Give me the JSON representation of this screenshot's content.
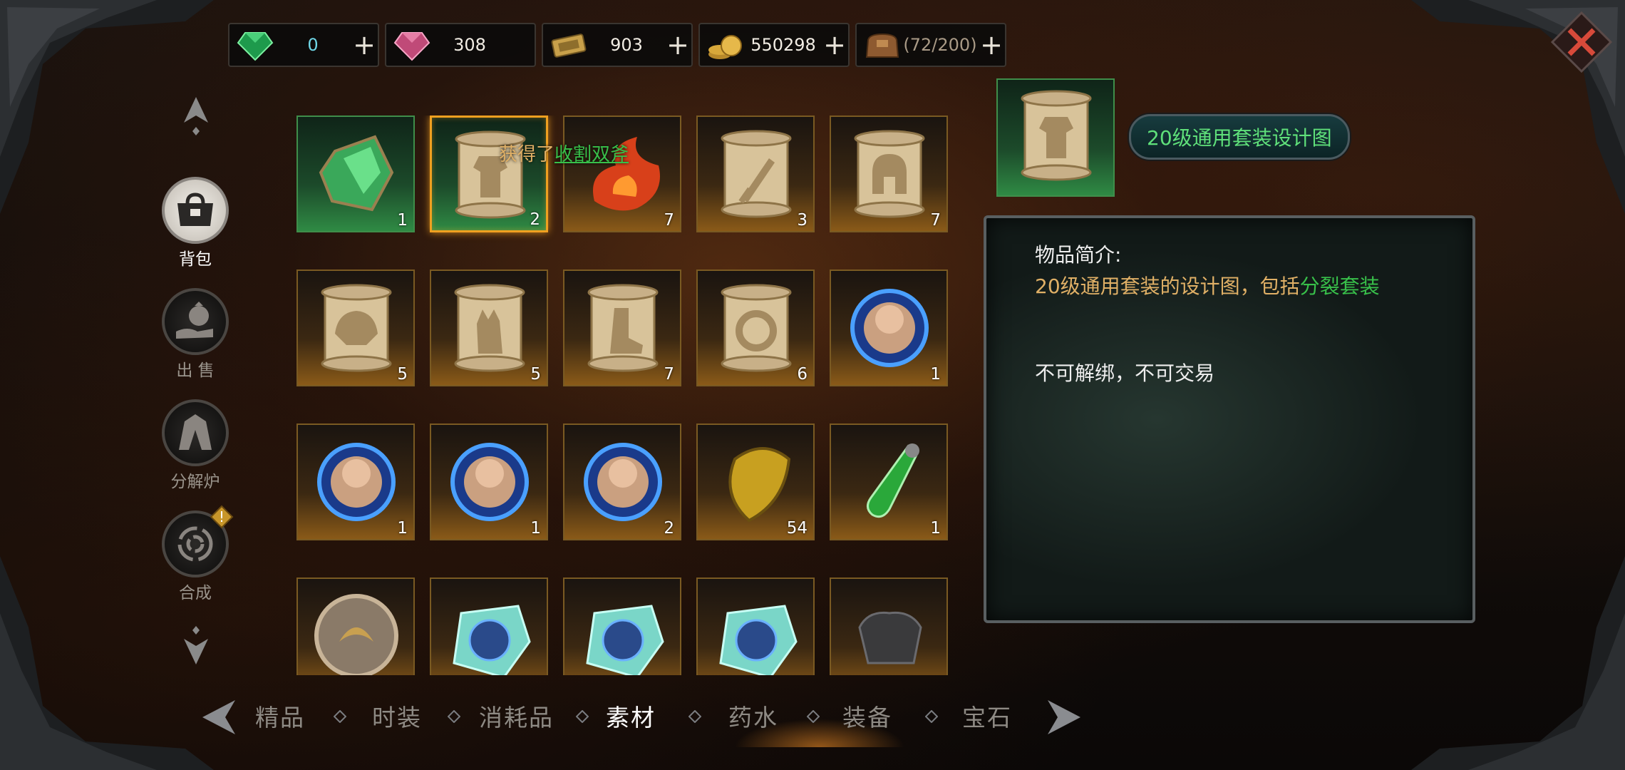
{
  "currencies": [
    {
      "icon": "emerald-gem-icon",
      "value": "0",
      "style": "cyan"
    },
    {
      "icon": "pink-diamond-icon",
      "value": "308",
      "style": ""
    },
    {
      "icon": "gold-ticket-icon",
      "value": "903",
      "style": ""
    },
    {
      "icon": "gold-coins-icon",
      "value": "550298",
      "style": ""
    },
    {
      "icon": "bag-icon",
      "value": "(72/200)",
      "style": "muted"
    }
  ],
  "currency_plus": "+",
  "sidebar": {
    "items": [
      {
        "label": "背包",
        "icon": "bag-icon"
      },
      {
        "label": "出 售",
        "icon": "money-bag-hand-icon"
      },
      {
        "label": "分解炉",
        "icon": "furnace-icon"
      },
      {
        "label": "合成",
        "icon": "swirl-icon"
      }
    ],
    "badge": "!"
  },
  "grid": {
    "items": [
      {
        "icon": "green-ore-icon",
        "count": "1",
        "frame": "green"
      },
      {
        "icon": "scroll-armor-icon",
        "count": "2",
        "frame": "green"
      },
      {
        "icon": "fire-essence-icon",
        "count": "7",
        "frame": "orange"
      },
      {
        "icon": "scroll-sword-icon",
        "count": "3",
        "frame": "orange"
      },
      {
        "icon": "scroll-helmet-icon",
        "count": "7",
        "frame": "orange"
      },
      {
        "icon": "scroll-shoulder-icon",
        "count": "5",
        "frame": "orange"
      },
      {
        "icon": "scroll-glove-icon",
        "count": "5",
        "frame": "orange"
      },
      {
        "icon": "scroll-boot-icon",
        "count": "7",
        "frame": "orange"
      },
      {
        "icon": "scroll-ring-icon",
        "count": "6",
        "frame": "orange"
      },
      {
        "icon": "hero-orb-icon",
        "count": "1",
        "frame": "orange"
      },
      {
        "icon": "hero-orb-icon",
        "count": "1",
        "frame": "orange"
      },
      {
        "icon": "hero-orb-icon",
        "count": "1",
        "frame": "orange"
      },
      {
        "icon": "hero-orb-icon",
        "count": "2",
        "frame": "orange"
      },
      {
        "icon": "yellow-stone-icon",
        "count": "54",
        "frame": "orange"
      },
      {
        "icon": "green-potion-icon",
        "count": "1",
        "frame": "orange"
      },
      {
        "icon": "bronze-emblem-icon",
        "count": "",
        "frame": "orange"
      },
      {
        "icon": "crystal-hero-icon",
        "count": "",
        "frame": "orange"
      },
      {
        "icon": "crystal-hero-icon",
        "count": "",
        "frame": "orange"
      },
      {
        "icon": "crystal-hero-icon",
        "count": "",
        "frame": "orange"
      },
      {
        "icon": "black-armor-icon",
        "count": "",
        "frame": "orange"
      }
    ]
  },
  "toast": {
    "prefix": "获得了",
    "item": "收割双斧"
  },
  "detail": {
    "name": "20级通用套装设计图",
    "heading": "物品简介:",
    "desc_main": "20级通用套装的设计图，包括",
    "desc_highlight": "分裂套装",
    "note": "不可解绑，不可交易"
  },
  "tabs": [
    "精品",
    "时装",
    "消耗品",
    "素材",
    "药水",
    "装备",
    "宝石"
  ],
  "active_tab": "素材",
  "colors": {
    "accent_green": "#38c04a",
    "accent_gold": "#e0b066",
    "selected_border": "#f0a020"
  }
}
